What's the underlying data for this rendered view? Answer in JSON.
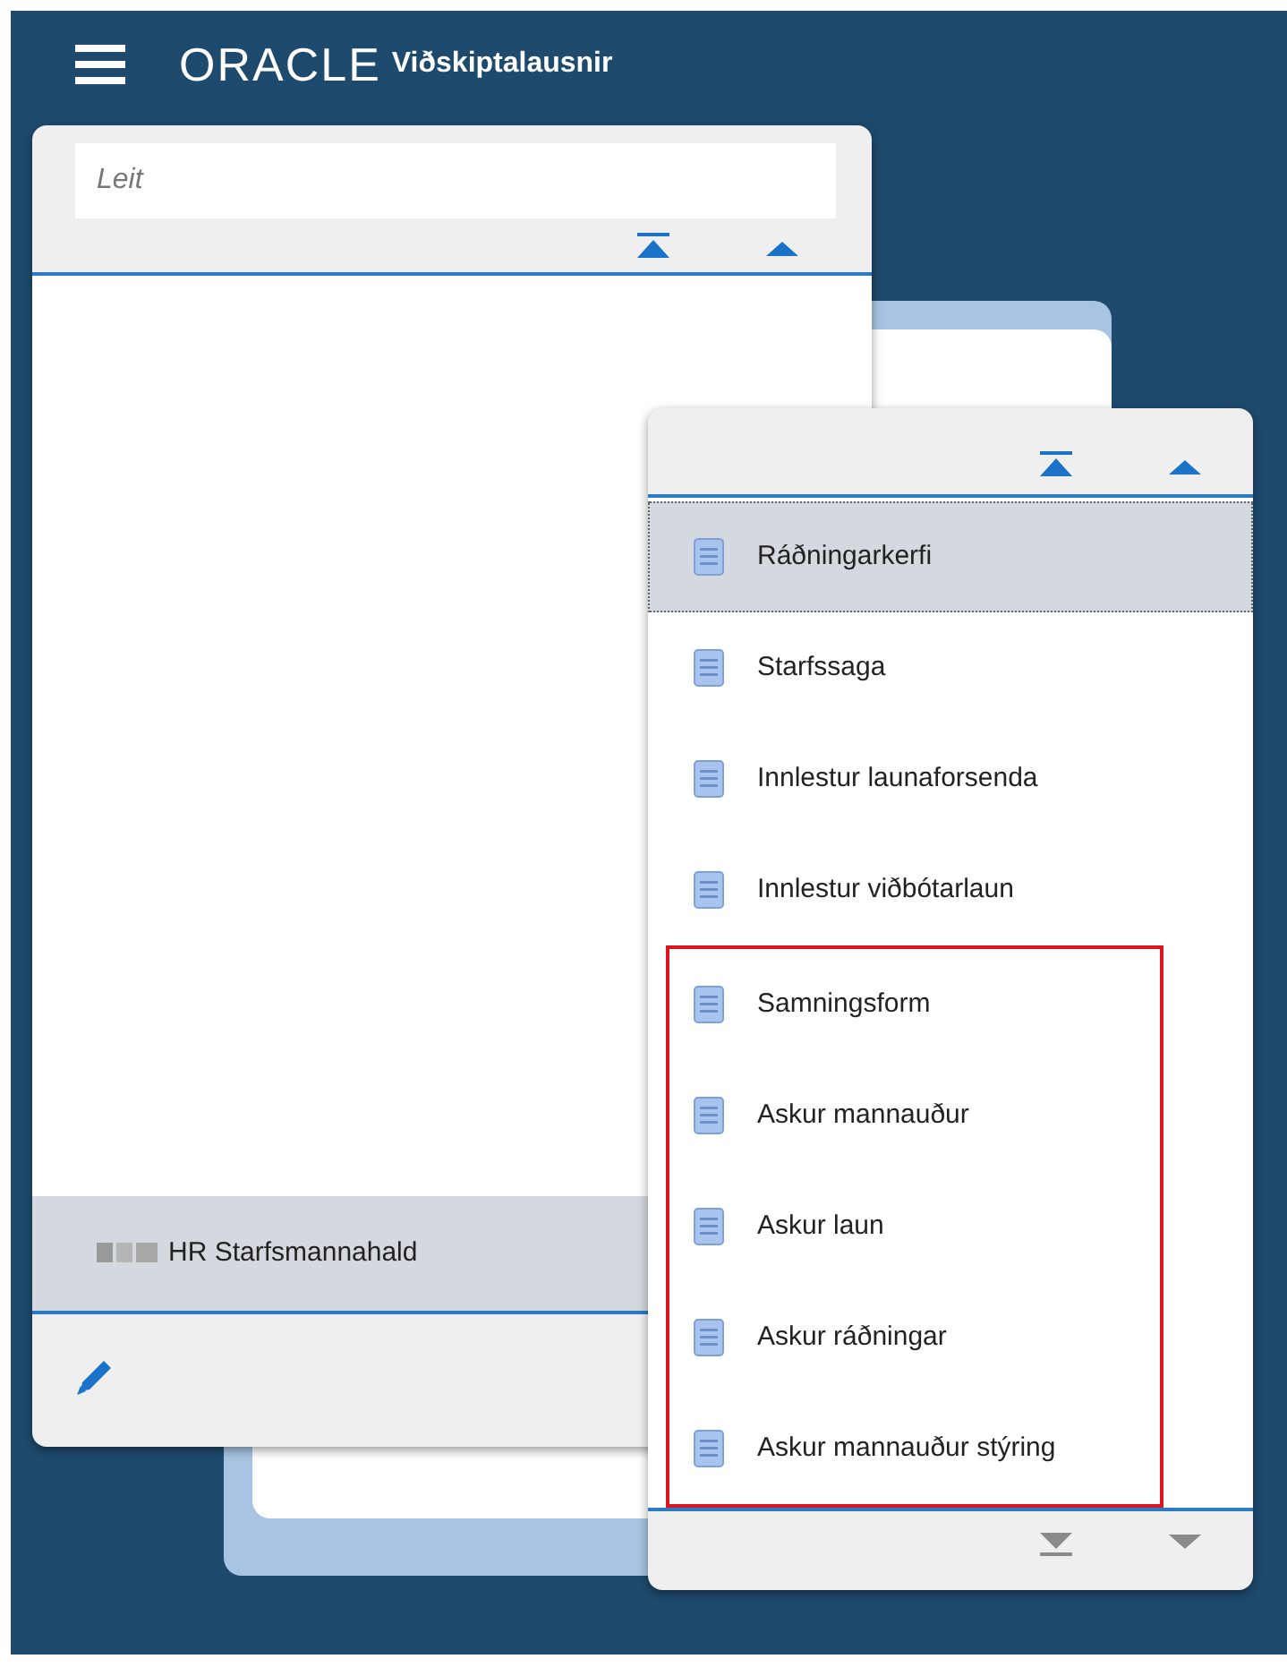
{
  "header": {
    "logo": "ORACLE",
    "title": "Viðskiptalausnir"
  },
  "menu_panel": {
    "search": {
      "placeholder": "Leit"
    },
    "scroll_buttons": [
      {
        "kind": "top",
        "disabled": false
      },
      {
        "kind": "up",
        "disabled": false
      }
    ],
    "groups": [
      {
        "label": "HR Starfsmannahald",
        "selected": true
      }
    ]
  },
  "submenu_panel": {
    "scroll_top": [
      {
        "kind": "top",
        "disabled": false
      },
      {
        "kind": "up",
        "disabled": false
      }
    ],
    "items": [
      {
        "label": "Ráðningarkerfi",
        "selected": true,
        "highlighted": false
      },
      {
        "label": "Starfssaga",
        "selected": false,
        "highlighted": false
      },
      {
        "label": "Innlestur launaforsenda",
        "selected": false,
        "highlighted": false
      },
      {
        "label": "Innlestur viðbótarlaun",
        "selected": false,
        "highlighted": false
      },
      {
        "label": "Samningsform",
        "selected": false,
        "highlighted": true
      },
      {
        "label": "Askur mannauður",
        "selected": false,
        "highlighted": true
      },
      {
        "label": "Askur laun",
        "selected": false,
        "highlighted": true
      },
      {
        "label": "Askur ráðningar",
        "selected": false,
        "highlighted": true
      },
      {
        "label": "Askur mannauður stýring",
        "selected": false,
        "highlighted": true
      }
    ],
    "scroll_bottom": [
      {
        "kind": "bottom",
        "disabled": true
      },
      {
        "kind": "down",
        "disabled": true
      }
    ]
  }
}
